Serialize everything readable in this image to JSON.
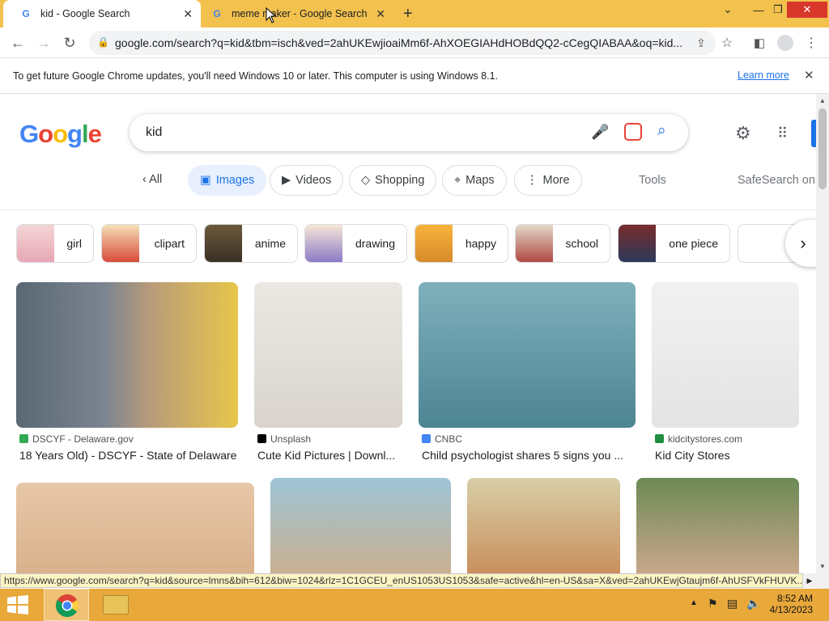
{
  "tabs": [
    {
      "title": "kid - Google Search",
      "active": true
    },
    {
      "title": "meme maker - Google Search",
      "active": false
    }
  ],
  "address": {
    "url": "google.com/search?q=kid&tbm=isch&ved=2ahUKEwjioaiMm6f-AhXOEGIAHdHOBdQQ2-cCegQIABAA&oq=kid..."
  },
  "infobar": {
    "message": "To get future Google Chrome updates, you'll need Windows 10 or later. This computer is using Windows 8.1.",
    "link": "Learn more"
  },
  "logo": {
    "letters": [
      "G",
      "o",
      "o",
      "g",
      "l",
      "e"
    ],
    "colors": [
      "#4285f4",
      "#ea4335",
      "#fbbc05",
      "#4285f4",
      "#34a853",
      "#ea4335"
    ]
  },
  "search": {
    "query": "kid"
  },
  "nav": {
    "back_label": "All",
    "items": [
      {
        "label": "Images",
        "active": true
      },
      {
        "label": "Videos"
      },
      {
        "label": "Shopping"
      },
      {
        "label": "Maps"
      },
      {
        "label": "More"
      }
    ],
    "tools": "Tools",
    "safesearch": "SafeSearch on"
  },
  "refinements": [
    "girl",
    "clipart",
    "anime",
    "drawing",
    "happy",
    "school",
    "one piece"
  ],
  "results_row1": [
    {
      "source": "DSCYF - Delaware.gov",
      "title": "18 Years Old) - DSCYF - State of Delaware"
    },
    {
      "source": "Unsplash",
      "title": "Cute Kid Pictures | Downl..."
    },
    {
      "source": "CNBC",
      "title": "Child psychologist shares 5 signs you ..."
    },
    {
      "source": "kidcitystores.com",
      "title": "Kid City Stores"
    }
  ],
  "statusbar": {
    "url": "https://www.google.com/search?q=kid&source=lmns&bih=612&biw=1024&rlz=1C1GCEU_enUS1053US1053&safe=active&hl=en-US&sa=X&ved=2ahUKEwjGtaujm6f-AhUSFVkFHUVK..."
  },
  "taskbar": {
    "time": "8:52 AM",
    "date": "4/13/2023"
  },
  "colors": {
    "titlebar": "#f2c14e",
    "accent": "#1a73e8",
    "taskbar": "#e9a83a"
  }
}
